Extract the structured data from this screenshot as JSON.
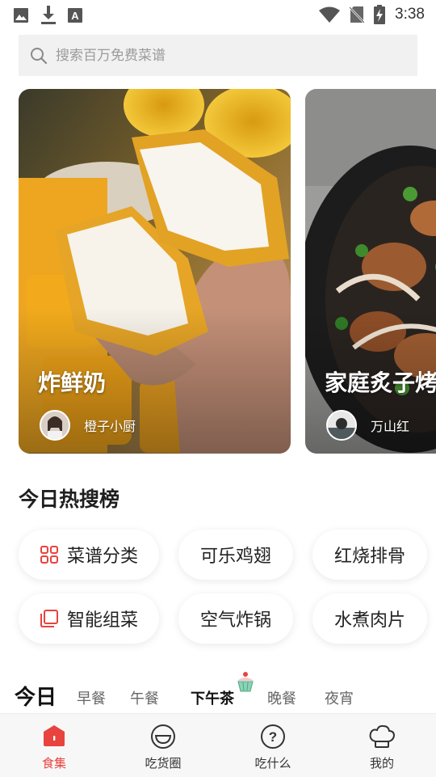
{
  "status_bar": {
    "time": "3:38",
    "icons": [
      "image-icon",
      "download-icon",
      "font-icon",
      "wifi-icon",
      "no-sim-icon",
      "battery-charging-icon"
    ]
  },
  "search": {
    "placeholder": "搜索百万免费菜谱"
  },
  "cards": [
    {
      "title": "炸鲜奶",
      "author": "橙子小厨"
    },
    {
      "title": "家庭炙子烤",
      "author": "万山红"
    }
  ],
  "hot_search": {
    "title": "今日热搜榜",
    "items": [
      {
        "label": "菜谱分类",
        "icon": "grid-icon"
      },
      {
        "label": "可乐鸡翅"
      },
      {
        "label": "红烧排骨"
      },
      {
        "label": "智能组菜",
        "icon": "stack-icon"
      },
      {
        "label": "空气炸锅"
      },
      {
        "label": "水煮肉片"
      }
    ]
  },
  "meal_tabs": {
    "today": "今日",
    "items": [
      "早餐",
      "午餐",
      "下午茶",
      "晚餐",
      "夜宵"
    ],
    "active": "下午茶"
  },
  "bottom_nav": [
    {
      "label": "食集",
      "icon": "home-icon",
      "active": true
    },
    {
      "label": "吃货圈",
      "icon": "smile-icon"
    },
    {
      "label": "吃什么",
      "icon": "question-icon"
    },
    {
      "label": "我的",
      "icon": "chef-hat-icon"
    }
  ],
  "colors": {
    "accent": "#e8433e",
    "search_bg": "#f1f1f1",
    "nav_bg": "#f7f7f7"
  }
}
